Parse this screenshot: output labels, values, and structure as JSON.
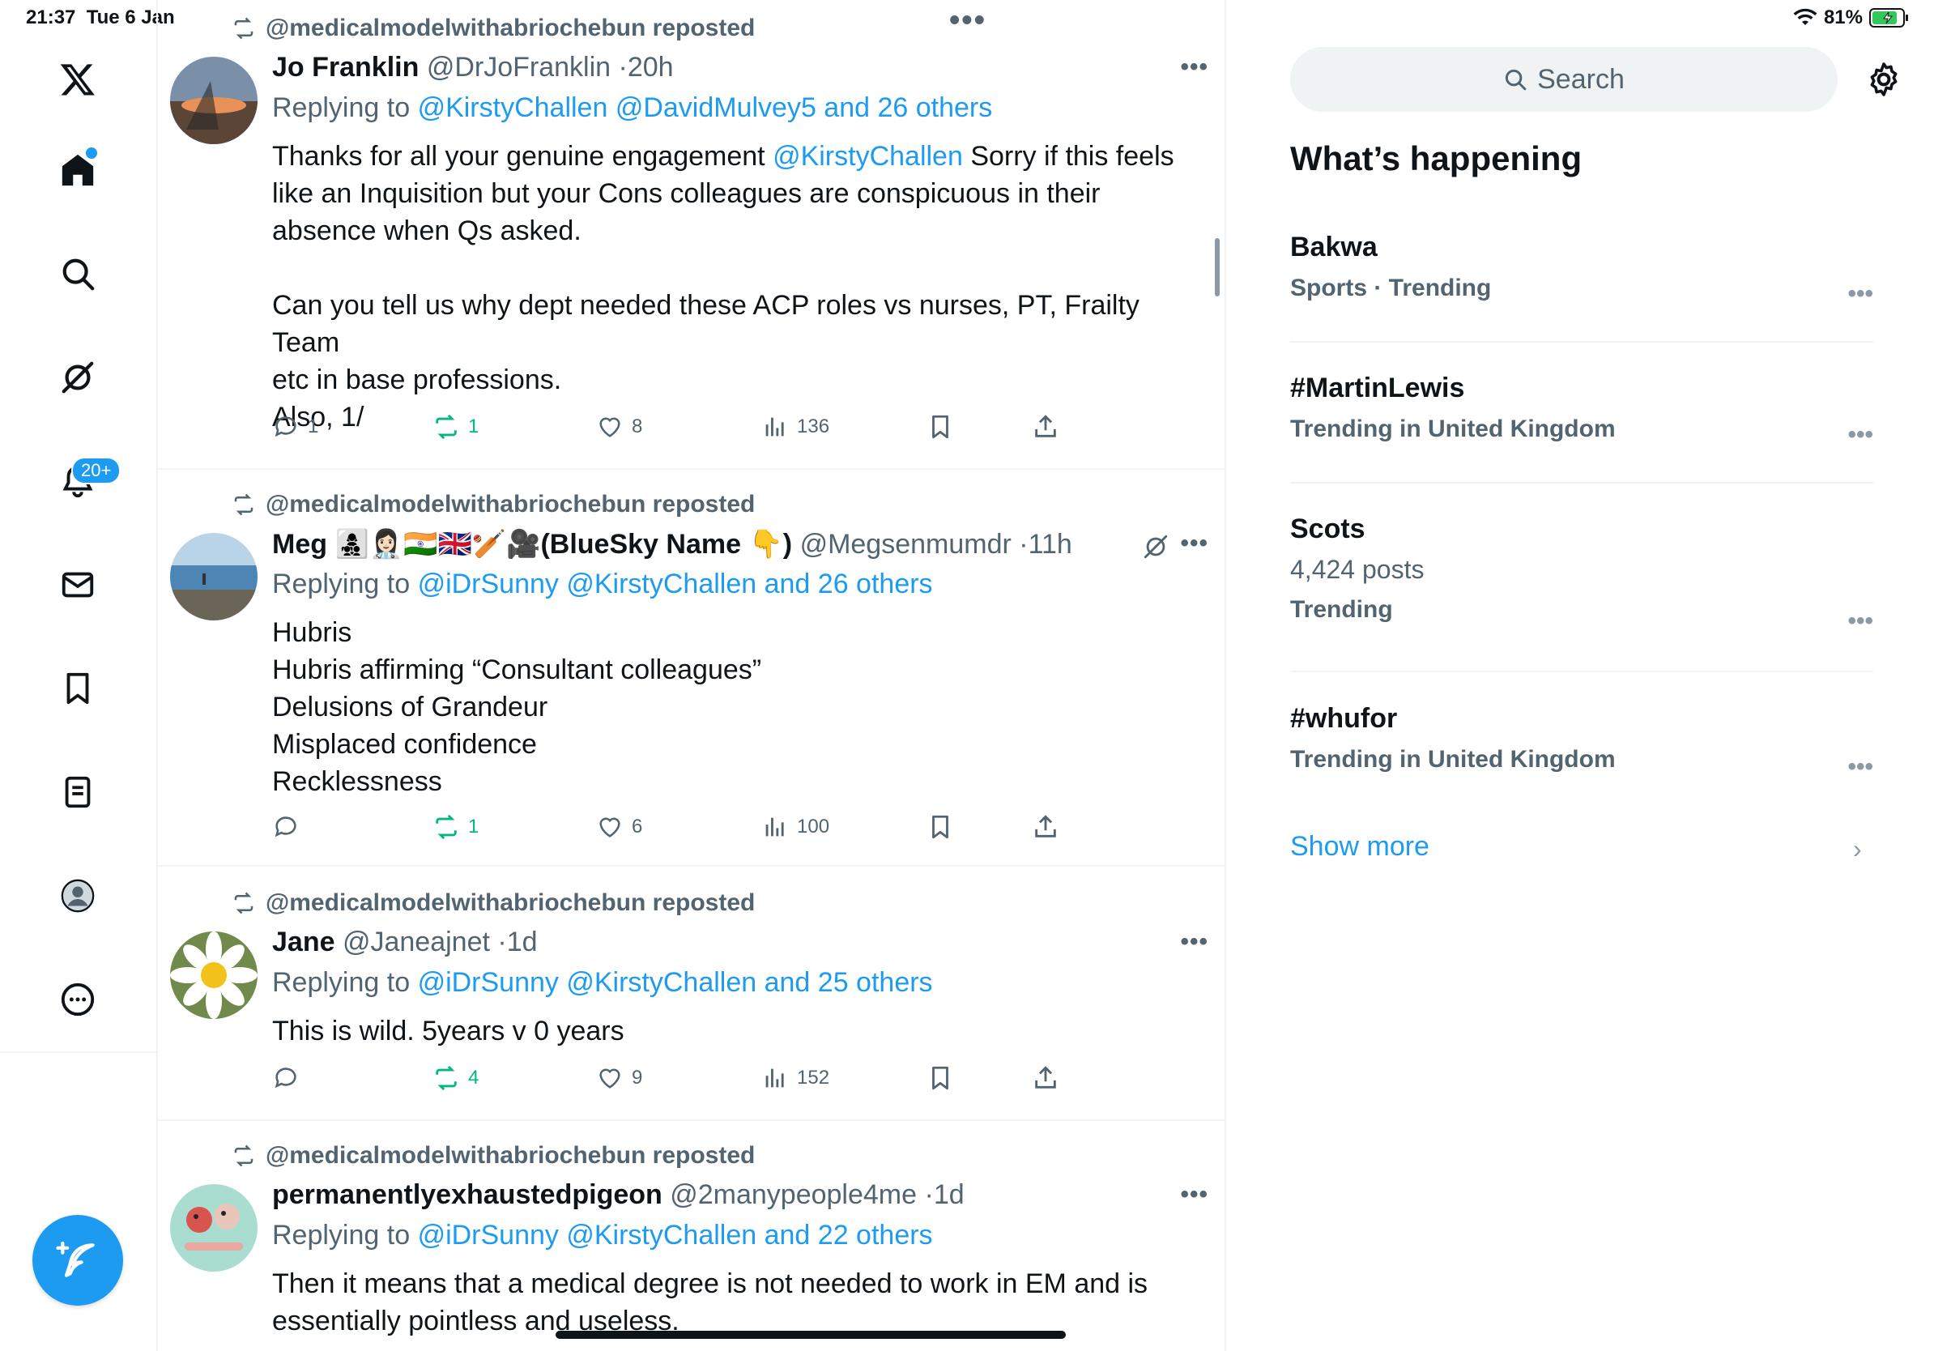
{
  "status": {
    "time": "21:37",
    "date": "Tue 6 Jan",
    "battery": "81%"
  },
  "nav": {
    "notifications_badge": "20+"
  },
  "tweets": [
    {
      "repost_by": "@medicalmodelwithabriochebun reposted",
      "name": "Jo Franklin",
      "handle": "@DrJoFranklin",
      "time": "20h",
      "replying_prefix": "Replying to",
      "replying_links": "@KirstyChallen @DavidMulvey5 and 26 others",
      "body_lines": [
        {
          "text": "Thanks for all your genuine engagement ",
          "mention": "@KirstyChallen",
          "after": " Sorry if this feels"
        },
        {
          "text": "like an Inquisition but your Cons colleagues are conspicuous in their"
        },
        {
          "text": "absence when Qs asked."
        },
        {
          "text": ""
        },
        {
          "text": "Can you tell us why dept needed these ACP roles vs nurses, PT, Frailty Team"
        },
        {
          "text": "etc in base professions."
        },
        {
          "text": "Also, 1/"
        }
      ],
      "replies": "1",
      "reposts": "1",
      "likes": "8",
      "views": "136"
    },
    {
      "repost_by": "@medicalmodelwithabriochebun reposted",
      "name": "Meg 👩‍👧‍👦👩🏻‍⚕️🇮🇳🇬🇧🏏🎥(BlueSky Name 👇)",
      "handle": "@Megsenmumdr",
      "time": "11h",
      "replying_prefix": "Replying to",
      "replying_links": "@iDrSunny @KirstyChallen and 26 others",
      "body_lines": [
        {
          "text": "Hubris"
        },
        {
          "text": "Hubris affirming “Consultant colleagues”"
        },
        {
          "text": "Delusions of Grandeur"
        },
        {
          "text": "Misplaced confidence"
        },
        {
          "text": "Recklessness"
        }
      ],
      "replies": "",
      "reposts": "1",
      "likes": "6",
      "views": "100"
    },
    {
      "repost_by": "@medicalmodelwithabriochebun reposted",
      "name": "Jane",
      "handle": "@Janeajnet",
      "time": "1d",
      "replying_prefix": "Replying to",
      "replying_links": "@iDrSunny @KirstyChallen and 25 others",
      "body_lines": [
        {
          "text": "This is wild. 5years v 0 years"
        }
      ],
      "replies": "",
      "reposts": "4",
      "likes": "9",
      "views": "152"
    },
    {
      "repost_by": "@medicalmodelwithabriochebun reposted",
      "name": "permanentlyexhaustedpigeon",
      "handle": "@2manypeople4me",
      "time": "1d",
      "replying_prefix": "Replying to",
      "replying_links": "@iDrSunny @KirstyChallen and 22 others",
      "body_lines": [
        {
          "text": "Then it means that a medical degree is not needed to work in EM and is"
        },
        {
          "text": "essentially pointless and useless."
        }
      ]
    }
  ],
  "right": {
    "search_placeholder": "Search",
    "whats_happening": "What’s happening",
    "trends": [
      {
        "name": "Bakwa",
        "meta": "Sports · Trending"
      },
      {
        "name": "#MartinLewis",
        "meta": "Trending in United Kingdom"
      },
      {
        "name": "Scots",
        "posts": "4,424 posts",
        "meta": "Trending"
      },
      {
        "name": "#whufor",
        "meta": "Trending in United Kingdom"
      }
    ],
    "show_more": "Show more"
  },
  "colors": {
    "accent": "#1d9bf0",
    "repost_green": "#00ba7c",
    "muted": "#536471"
  }
}
